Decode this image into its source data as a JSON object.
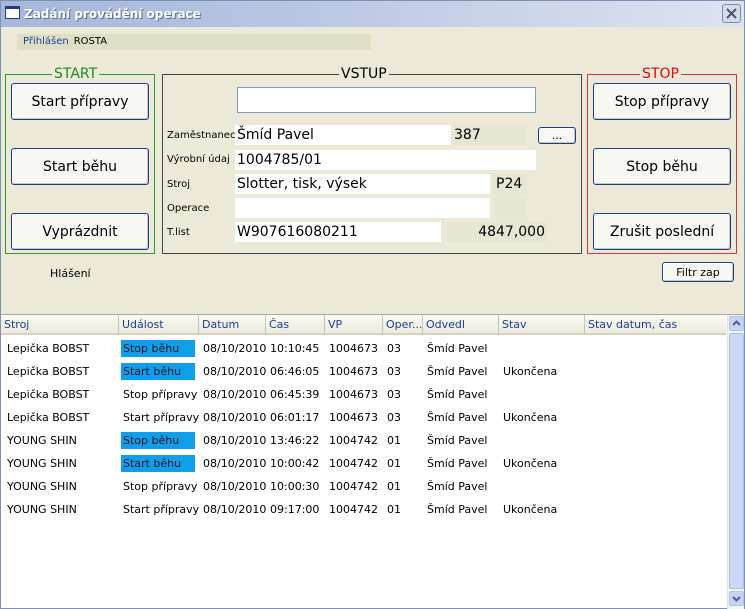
{
  "window": {
    "title": "Zadání provádění operace",
    "accent": "#a6b6d9"
  },
  "login": {
    "label": "Přihlášen",
    "user": "ROSTA"
  },
  "start": {
    "legend": "START",
    "start_priprava": "Start přípravy",
    "start_behu": "Start běhu",
    "vyprazdnit": "Vyprázdnit"
  },
  "vstup": {
    "legend": "VSTUP",
    "input_value": "",
    "zamestnanec_label": "Zaměstnanec",
    "zamestnanec_name": "Šmíd Pavel",
    "zamestnanec_id": "387",
    "browse_label": "...",
    "vyrobni_label": "Výrobní údaj",
    "vyrobni_value": "1004785/01",
    "stroj_label": "Stroj",
    "stroj_value": "Slotter, tisk, výsek",
    "stroj_code": "P24",
    "operace_label": "Operace",
    "operace_value": "",
    "operace_code": "",
    "tlist_label": "T.list",
    "tlist_value": "W907616080211",
    "tlist_amount": "4847,000"
  },
  "stop": {
    "legend": "STOP",
    "stop_priprava": "Stop přípravy",
    "stop_behu": "Stop běhu",
    "zrusit": "Zrušit poslední"
  },
  "hlaseni_label": "Hlášení",
  "filtr_label": "Filtr zap",
  "table": {
    "columns": [
      "Stroj",
      "Událost",
      "Datum",
      "Čas",
      "VP",
      "Oper...",
      "Odvedl",
      "Stav",
      "Stav datum, čas"
    ],
    "rows": [
      {
        "stroj": "Lepička BOBST",
        "udalost": "Stop běhu",
        "datum": "08/10/2010",
        "cas": "10:10:45",
        "vp": "1004673",
        "oper": "03",
        "odvedl": "Šmíd Pavel",
        "stav": "",
        "stav_cas": ""
      },
      {
        "stroj": "Lepička BOBST",
        "udalost": "Start běhu",
        "datum": "08/10/2010",
        "cas": "06:46:05",
        "vp": "1004673",
        "oper": "03",
        "odvedl": "Šmíd Pavel",
        "stav": "Ukončena",
        "stav_cas": ""
      },
      {
        "stroj": "Lepička BOBST",
        "udalost": "Stop přípravy",
        "datum": "08/10/2010",
        "cas": "06:45:39",
        "vp": "1004673",
        "oper": "03",
        "odvedl": "Šmíd Pavel",
        "stav": "",
        "stav_cas": ""
      },
      {
        "stroj": "Lepička BOBST",
        "udalost": "Start přípravy",
        "datum": "08/10/2010",
        "cas": "06:01:17",
        "vp": "1004673",
        "oper": "03",
        "odvedl": "Šmíd Pavel",
        "stav": "Ukončena",
        "stav_cas": ""
      },
      {
        "stroj": "YOUNG SHIN",
        "udalost": "Stop běhu",
        "datum": "08/10/2010",
        "cas": "13:46:22",
        "vp": "1004742",
        "oper": "01",
        "odvedl": "Šmíd Pavel",
        "stav": "",
        "stav_cas": ""
      },
      {
        "stroj": "YOUNG SHIN",
        "udalost": "Start běhu",
        "datum": "08/10/2010",
        "cas": "10:00:42",
        "vp": "1004742",
        "oper": "01",
        "odvedl": "Šmíd Pavel",
        "stav": "Ukončena",
        "stav_cas": ""
      },
      {
        "stroj": "YOUNG SHIN",
        "udalost": "Stop přípravy",
        "datum": "08/10/2010",
        "cas": "10:00:30",
        "vp": "1004742",
        "oper": "01",
        "odvedl": "Šmíd Pavel",
        "stav": "",
        "stav_cas": ""
      },
      {
        "stroj": "YOUNG SHIN",
        "udalost": "Start přípravy",
        "datum": "08/10/2010",
        "cas": "09:17:00",
        "vp": "1004742",
        "oper": "01",
        "odvedl": "Šmíd Pavel",
        "stav": "Ukončena",
        "stav_cas": ""
      }
    ]
  },
  "colors": {
    "highlight": "#0f9ee9",
    "start_green": "#1a8f1a",
    "stop_red": "#d01010",
    "header_text": "#1a3f9d"
  }
}
